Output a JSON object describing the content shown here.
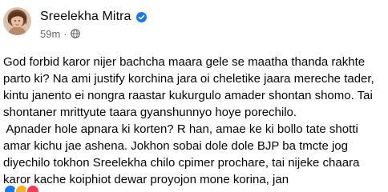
{
  "author": {
    "name": "Sreelekha Mitra",
    "avatar_icon": "profile-photo",
    "verified_icon": "verified-badge-icon",
    "verified_color": "#1877f2"
  },
  "meta": {
    "timestamp": "59m",
    "separator": "·",
    "audience_icon": "globe-icon"
  },
  "post": {
    "lines": [
      "God forbid karor nijer bachcha maara gele se maatha thanda rakhte",
      "parto ki? Na ami justify korchina jara oi cheletike jaara mereche tader,",
      "kintu janento ei nongra raastar kukurgulo amader shontan shomo. Tai",
      "shontaner mrittyute taara gyanshunnyo hoye porechilo.",
      " Apnader hole apnara ki korten? R han, amae ke ki bollo tate shotti",
      "amar kichu jae ashena. Jokhon sobai dole dole BJP ba tmcte jog",
      "diyechilo tokhon Sreelekha chilo cpimer prochare, tai nijeke chaara",
      "karor kache koiphiot dewar proyojon mone korina, jan"
    ]
  },
  "reactions": [
    {
      "name": "like-reaction-icon",
      "color": "#1877f2"
    },
    {
      "name": "haha-reaction-icon",
      "color": "#f7b125"
    },
    {
      "name": "love-reaction-icon",
      "color": "#f33e58"
    }
  ]
}
